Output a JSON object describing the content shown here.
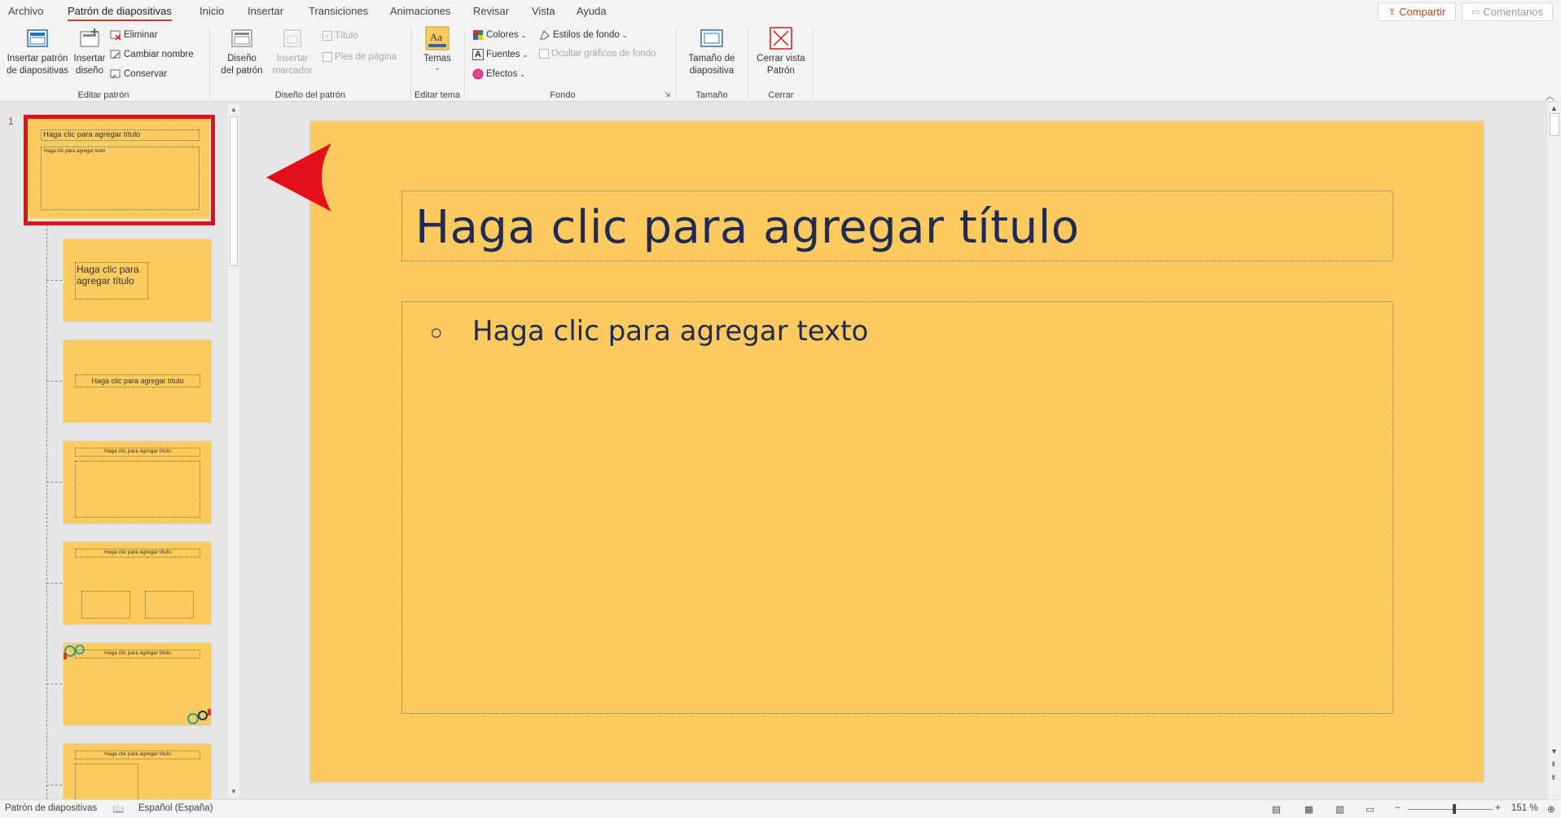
{
  "tabs": [
    "Archivo",
    "Patrón de diapositivas",
    "Inicio",
    "Insertar",
    "Transiciones",
    "Animaciones",
    "Revisar",
    "Vista",
    "Ayuda"
  ],
  "active_tab": "Patrón de diapositivas",
  "share_label": "Compartir",
  "comments_label": "Comentarios",
  "ribbon": {
    "groups": {
      "editar_patron": "Editar patrón",
      "diseno_patron": "Diseño del patrón",
      "editar_tema": "Editar tema",
      "fondo": "Fondo",
      "tamano": "Tamaño",
      "cerrar": "Cerrar"
    },
    "insertar_patron": [
      "Insertar patrón",
      "de diapositivas"
    ],
    "insertar_diseno": [
      "Insertar",
      "diseño"
    ],
    "eliminar": "Eliminar",
    "cambiar_nombre": "Cambiar nombre",
    "conservar": "Conservar",
    "diseno_del_patron": [
      "Diseño",
      "del patrón"
    ],
    "insertar_marcador": [
      "Insertar",
      "marcador"
    ],
    "titulo_check": "Título",
    "pies_check": "Pies de página",
    "temas": "Temas",
    "colores": "Colores",
    "fuentes": "Fuentes",
    "efectos": "Efectos",
    "estilos_fondo": "Estilos de fondo",
    "ocultar_graficos": "Ocultar gráficos de fondo",
    "tamano_diapositiva": [
      "Tamaño de",
      "diapositiva"
    ],
    "cerrar_vista": [
      "Cerrar vista",
      "Patrón"
    ]
  },
  "thumbnails": {
    "slide_number": "1",
    "master_title": "Haga clic para agregar título",
    "master_body": "Haga clic para agregar texto",
    "layout_title_multi": "Haga clic para agregar título",
    "layout_title": "Haga clic para agregar título"
  },
  "slide": {
    "title": "Haga clic para agregar título",
    "bullet": "○",
    "body": "Haga clic para agregar texto"
  },
  "colors": {
    "slide_bg": "#fcca5e",
    "title_text": "#1f2a55",
    "highlight": "#e3101c",
    "accent": "#c43e1c"
  },
  "status": {
    "mode": "Patrón de diapositivas",
    "language": "Español (España)",
    "zoom": "151 %"
  }
}
